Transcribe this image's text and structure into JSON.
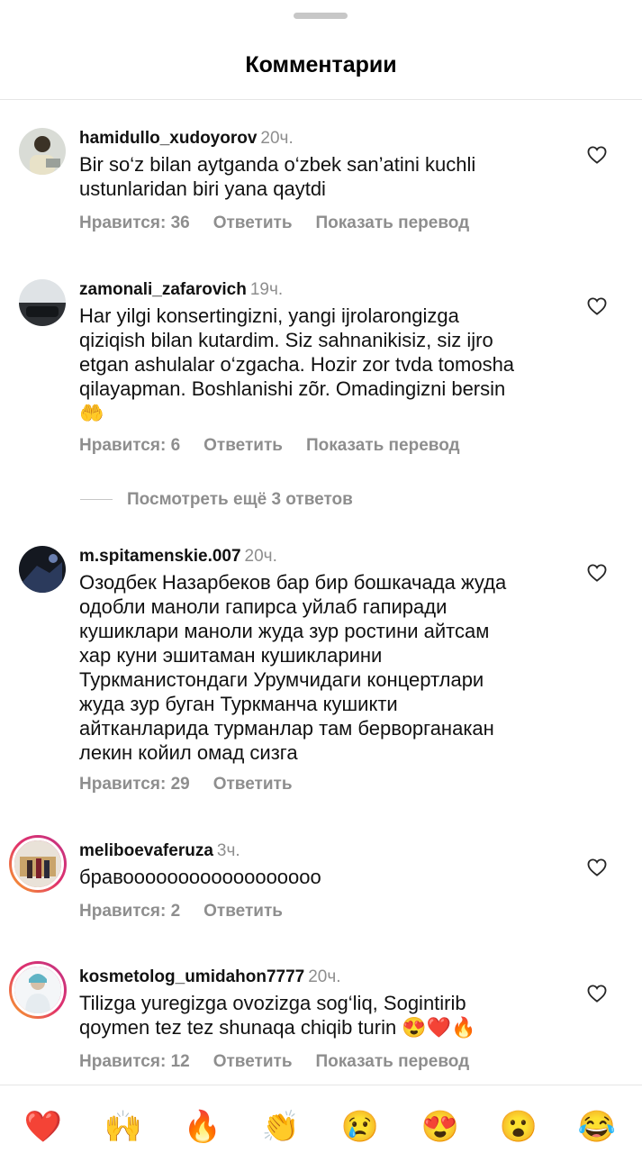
{
  "sheet": {
    "title": "Комментарии"
  },
  "comments": [
    {
      "username": "hamidullo_xudoyorov",
      "time": "20ч.",
      "text": "Bir so‘z bilan aytganda o‘zbek san’atini kuchli\nustunlaridan biri yana qaytdi",
      "likes": "Нравится: 36",
      "reply": "Ответить",
      "translate": "Показать перевод"
    },
    {
      "username": "zamonali_zafarovich",
      "time": "19ч.",
      "text": "Har yilgi konsertingizni, yangi ijrolarongizga\nqiziqish bilan kutardim. Siz sahnanikisiz, siz ijro\netgan ashulalar o‘zgacha. Hozir zor tvda tomosha\nqilayapman. Boshlanishi zõr. Omadingizni bersin\n🤲",
      "likes": "Нравится: 6",
      "reply": "Ответить",
      "translate": "Показать перевод"
    },
    {
      "username": "m.spitamenskie.007",
      "time": "20ч.",
      "text": "Озодбек Назарбеков бар бир бошкачада жуда\nодобли маноли гапирса уйлаб гапиради\nкушиклари маноли жуда зур ростини айтсам\nхар куни эшитаман кушикларини\nТуркманистондаги Урумчидаги концертлари\nжуда зур буган  Туркманча кушикти\nайтканларида турманлар там берворганакан\nлекин койил омад сизга",
      "likes": "Нравится: 29",
      "reply": "Ответить"
    },
    {
      "username": "meliboevaferuza",
      "time": "3ч.",
      "text": "бравоооооооооооооооооо",
      "likes": "Нравится: 2",
      "reply": "Ответить"
    },
    {
      "username": "kosmetolog_umidahon7777",
      "time": "20ч.",
      "text": "Tilizga yuregizga ovozizga sog‘liq, Sogintirib\nqoymen tez tez shunaqa chiqib turin 😍❤️🔥",
      "likes": "Нравится: 12",
      "reply": "Ответить",
      "translate": "Показать перевод"
    }
  ],
  "more_replies": "Посмотреть ещё 3 ответов",
  "emoji_bar": [
    "❤️",
    "🙌",
    "🔥",
    "👏",
    "😢",
    "😍",
    "😮",
    "😂"
  ],
  "icons": {
    "like": "heart-outline-icon"
  },
  "colors": {
    "secondary_text": "#8e8e8e",
    "story_ring_start": "#f9a825",
    "story_ring_end": "#c13584"
  }
}
